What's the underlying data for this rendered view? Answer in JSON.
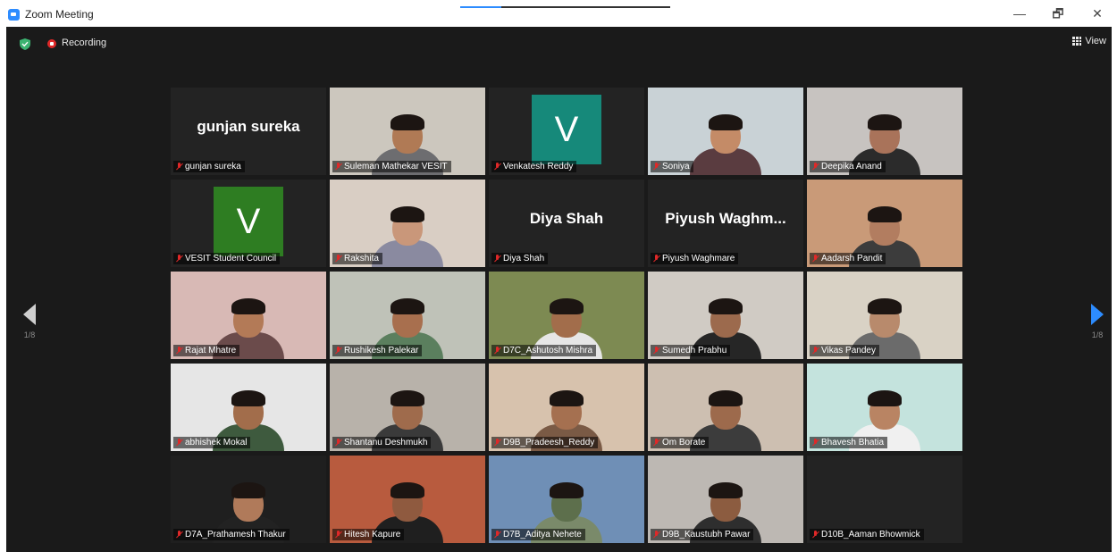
{
  "window": {
    "title": "Zoom Meeting",
    "minimize": "—",
    "restore": "🗗",
    "close": "✕"
  },
  "topbar": {
    "recording_label": "Recording",
    "view_label": "View"
  },
  "pager": {
    "left": "1/8",
    "right": "1/8"
  },
  "colors": {
    "accent": "#2d8cff",
    "recording": "#e02828",
    "active_border": "#a3d233",
    "avatar_teal": "#16897a",
    "avatar_green": "#2e7d22"
  },
  "participants": [
    {
      "name": "gunjan sureka",
      "display": "gunjan sureka",
      "kind": "name"
    },
    {
      "name": "Suleman Mathekar VESIT",
      "kind": "video",
      "bg": "#ccc7be",
      "skin": "#b07a55",
      "shirt": "#6d6d70"
    },
    {
      "name": "Venkatesh Reddy",
      "avatar": "V",
      "kind": "avatar",
      "color": "#16897a"
    },
    {
      "name": "Soniya",
      "kind": "video",
      "bg": "#c9d2d6",
      "skin": "#c48b67",
      "shirt": "#5a3c40"
    },
    {
      "name": "Deepika Anand",
      "kind": "video",
      "bg": "#c7c3c0",
      "skin": "#a9735a",
      "shirt": "#2b2b2b"
    },
    {
      "name": "VESIT Student Council",
      "avatar": "V",
      "kind": "avatar",
      "color": "#2e7d22"
    },
    {
      "name": "Rakshita",
      "kind": "video",
      "bg": "#d9cec4",
      "skin": "#c9977a",
      "shirt": "#8a8aa0",
      "active": true
    },
    {
      "name": "Diya Shah",
      "display": "Diya Shah",
      "kind": "name"
    },
    {
      "name": "Piyush Waghmare",
      "display": "Piyush  Waghm...",
      "kind": "name"
    },
    {
      "name": "Aadarsh Pandit",
      "kind": "video",
      "bg": "#c99a78",
      "skin": "#b27d60",
      "shirt": "#3c3c3c"
    },
    {
      "name": "Rajat Mhatre",
      "kind": "video",
      "bg": "#d8b9b5",
      "skin": "#b37a57",
      "shirt": "#6b4b4b"
    },
    {
      "name": "Rushikesh Palekar",
      "kind": "video",
      "bg": "#bfc2b8",
      "skin": "#a86f4e",
      "shirt": "#5b7f5e"
    },
    {
      "name": "D7C_Ashutosh Mishra",
      "kind": "video",
      "bg": "#7d8a52",
      "skin": "#a26d4b",
      "shirt": "#e6e6e6"
    },
    {
      "name": "Sumedh Prabhu",
      "kind": "video",
      "bg": "#d0cbc4",
      "skin": "#9c6a4d",
      "shirt": "#262626"
    },
    {
      "name": "Vikas Pandey",
      "kind": "video",
      "bg": "#d9d2c5",
      "skin": "#b88a6c",
      "shirt": "#6b6b6b"
    },
    {
      "name": "abhishek Mokal",
      "kind": "video",
      "bg": "#e6e6e6",
      "skin": "#a26d4b",
      "shirt": "#3e5a3e"
    },
    {
      "name": "Shantanu Deshmukh",
      "kind": "video",
      "bg": "#b8b2aa",
      "skin": "#9f6b4c",
      "shirt": "#3a3a3a"
    },
    {
      "name": "D9B_Pradeesh_Reddy",
      "kind": "video",
      "bg": "#d7c2ad",
      "skin": "#a57050",
      "shirt": "#7a5a45"
    },
    {
      "name": "Om Borate",
      "kind": "video",
      "bg": "#cdbfb1",
      "skin": "#9d6a4c",
      "shirt": "#3c3c3c"
    },
    {
      "name": "Bhavesh Bhatia",
      "kind": "video",
      "bg": "#c4e3dd",
      "skin": "#b98463",
      "shirt": "#f0f0f0"
    },
    {
      "name": "D7A_Prathamesh Thakur",
      "kind": "video",
      "bg": "#1f1f1f",
      "skin": "#b07a5a",
      "shirt": "#222222"
    },
    {
      "name": "Hitesh Kapure",
      "kind": "video",
      "bg": "#b85b3e",
      "skin": "#8f5a3f",
      "shirt": "#1f1f1f"
    },
    {
      "name": "D7B_Aditya Nehete",
      "kind": "video",
      "bg": "#6f8fb6",
      "skin": "#5d6f4c",
      "shirt": "#7a8a6a"
    },
    {
      "name": "D9B_Kaustubh Pawar",
      "kind": "video",
      "bg": "#bdb8b3",
      "skin": "#8c5c40",
      "shirt": "#2e2e2e"
    },
    {
      "name": "D10B_Aaman Bhowmick",
      "kind": "empty"
    }
  ]
}
